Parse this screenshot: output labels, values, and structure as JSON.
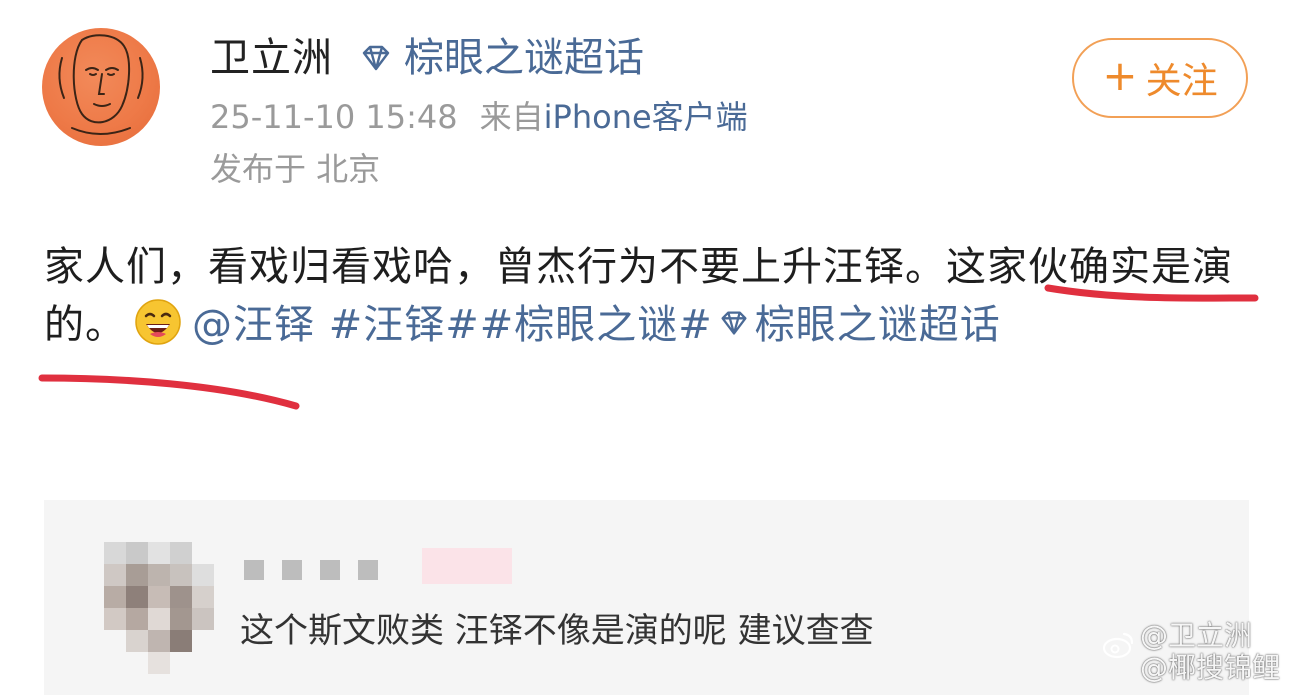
{
  "author": {
    "name": "卫立洲",
    "topic_tag": "棕眼之谜超话",
    "timestamp": "25-11-10 15:48",
    "source_prefix": "来自",
    "source_client": "iPhone客户端",
    "location": "发布于  北京"
  },
  "follow_button": {
    "plus": "+",
    "label": "关注"
  },
  "post": {
    "text_main": "家人们，看戏归看戏哈，曾杰行为不要上升汪铎。",
    "text_highlight": "这家伙确实是演的。",
    "mention": "@汪铎",
    "hashtag_1": "#汪铎#",
    "hashtag_2": "#棕眼之谜#",
    "topic_link": "棕眼之谜超话",
    "emoji": "laughing-emoji"
  },
  "quote": {
    "comment": "这个斯文败类  汪铎不像是演的呢  建议查查"
  },
  "watermark": {
    "line1": "@卫立洲",
    "line2": "@椰搜锦鲤"
  },
  "colors": {
    "link": "#4a6a96",
    "follow": "#ee8a2c",
    "underline": "#e0303f",
    "meta_gray": "#9a9a9a"
  }
}
